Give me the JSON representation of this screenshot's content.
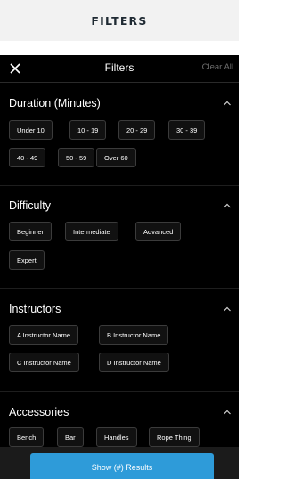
{
  "page": {
    "header_title": "FILTERS"
  },
  "topbar": {
    "title": "Filters",
    "clear_label": "Clear All"
  },
  "sections": [
    {
      "title": "Duration (Minutes)",
      "options": [
        "Under 10",
        "10 - 19",
        "20 - 29",
        "30 - 39",
        "40 - 49",
        "50 - 59",
        "Over 60"
      ]
    },
    {
      "title": "Difficulty",
      "options": [
        "Beginner",
        "Intermediate",
        "Advanced",
        "Expert"
      ]
    },
    {
      "title": "Instructors",
      "options": [
        "A Instructor Name",
        "B Instructor Name",
        "C Instructor Name",
        "D Instructor Name"
      ]
    },
    {
      "title": "Accessories",
      "options": [
        "Bench",
        "Bar",
        "Handles",
        "Rope Thing"
      ]
    }
  ],
  "footer": {
    "button_label": "Show (#) Results"
  },
  "colors": {
    "accent": "#2e9bd9",
    "panel_bg": "#000000",
    "header_bg": "#f2f2f2"
  },
  "icons": {
    "close": "close-icon",
    "collapse": "chevron-up-icon"
  }
}
